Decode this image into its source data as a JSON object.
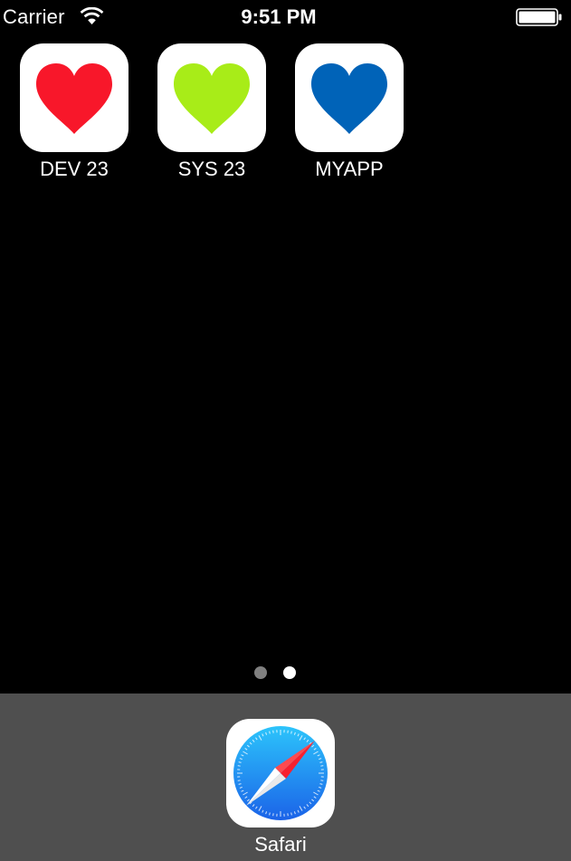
{
  "status_bar": {
    "carrier": "Carrier",
    "time": "9:51 PM",
    "wifi_icon": "wifi-icon",
    "battery_icon": "battery-icon"
  },
  "home_apps": [
    {
      "label": "DEV 23",
      "icon": "heart-icon",
      "color": "#f8172a"
    },
    {
      "label": "SYS 23",
      "icon": "heart-icon",
      "color": "#a8ec18"
    },
    {
      "label": "MYAPP",
      "icon": "heart-icon",
      "color": "#0063b8"
    }
  ],
  "page_indicator": {
    "pages": 2,
    "current_page": 2,
    "inactive_color": "#808080",
    "active_color": "#ffffff"
  },
  "dock": {
    "apps": [
      {
        "label": "Safari",
        "icon": "compass-icon"
      }
    ],
    "background": "#4f4f4f"
  }
}
